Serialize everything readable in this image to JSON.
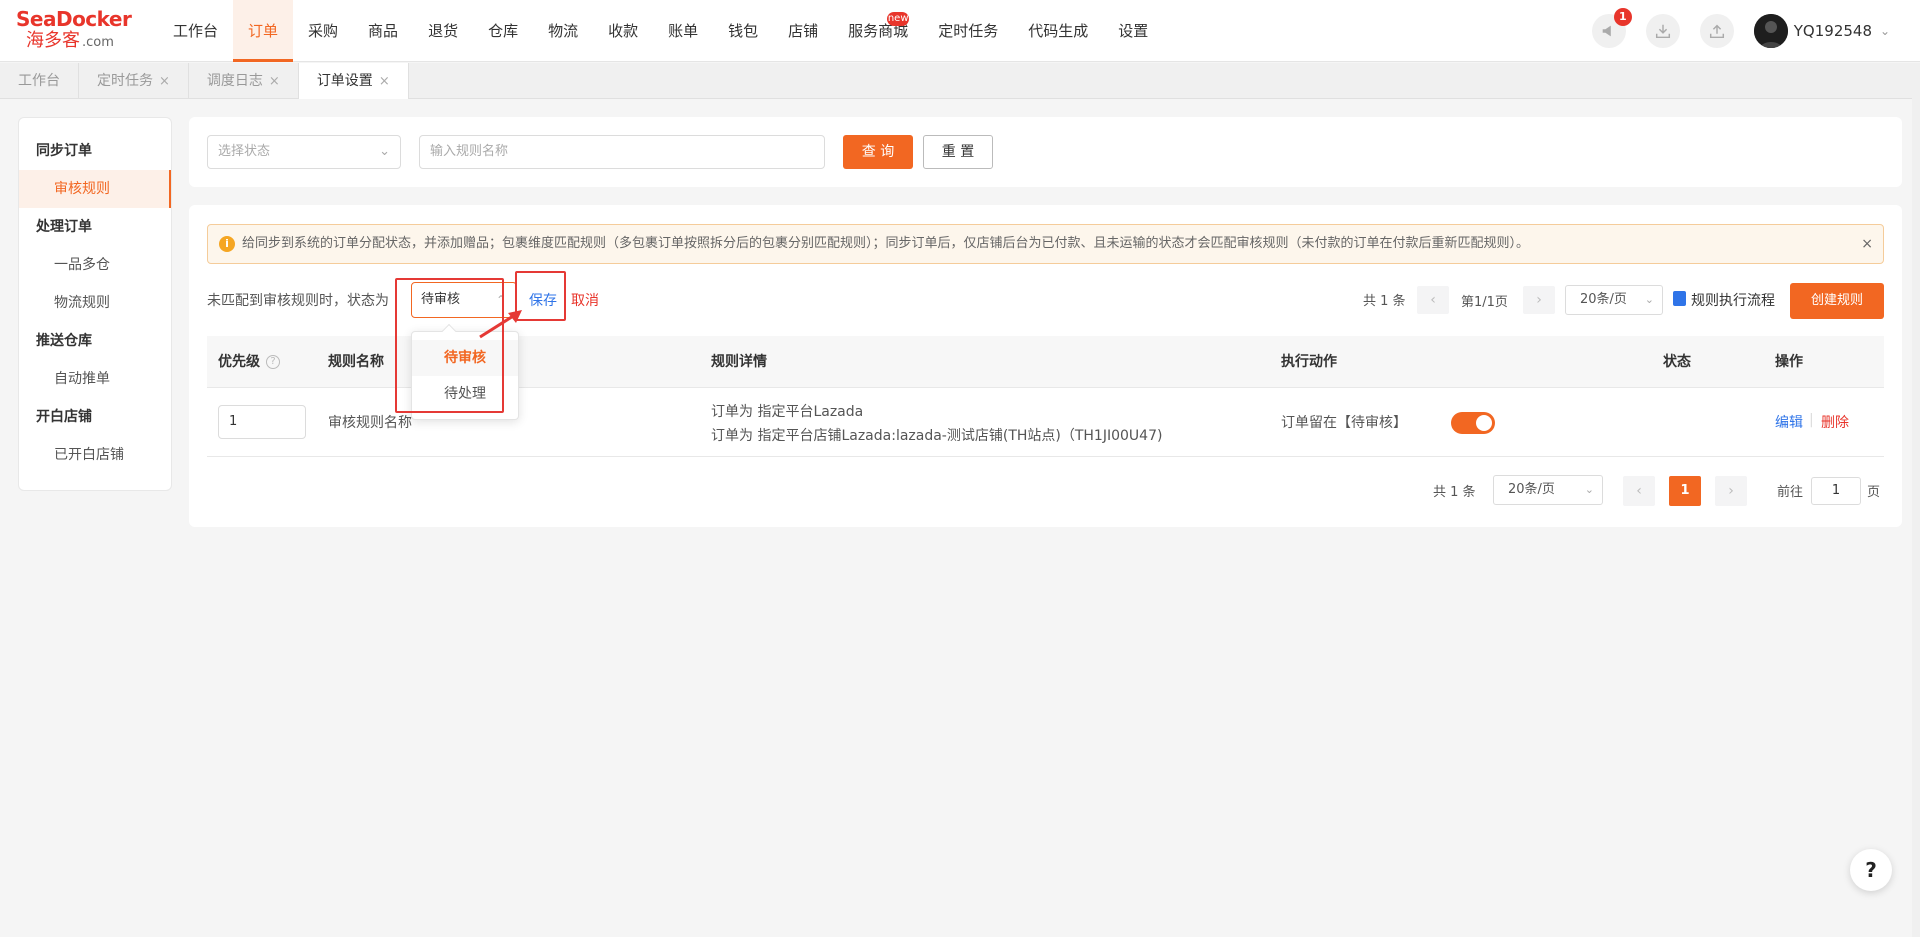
{
  "logo": {
    "text_en": "SeaDocker",
    "text_cn": "海多客",
    "text_domain": ".com"
  },
  "nav": {
    "items": [
      {
        "label": "工作台"
      },
      {
        "label": "订单",
        "active": true
      },
      {
        "label": "采购"
      },
      {
        "label": "商品"
      },
      {
        "label": "退货"
      },
      {
        "label": "仓库"
      },
      {
        "label": "物流"
      },
      {
        "label": "收款"
      },
      {
        "label": "账单"
      },
      {
        "label": "钱包"
      },
      {
        "label": "店铺"
      },
      {
        "label": "服务商城",
        "badge": "new"
      },
      {
        "label": "定时任务"
      },
      {
        "label": "代码生成"
      },
      {
        "label": "设置"
      }
    ]
  },
  "header": {
    "notification_count": "1",
    "username": "YQ192548",
    "icons": [
      "megaphone-icon",
      "download-icon",
      "upload-icon",
      "avatar",
      "chevron-down-icon"
    ]
  },
  "tabs": [
    {
      "label": "工作台"
    },
    {
      "label": "定时任务",
      "closable": "×"
    },
    {
      "label": "调度日志",
      "closable": "×"
    },
    {
      "label": "订单设置",
      "closable": "×",
      "active": true
    }
  ],
  "sidebar": {
    "groups": [
      {
        "label": "同步订单",
        "items": [
          {
            "label": "审核规则",
            "active": true
          }
        ]
      },
      {
        "label": "处理订单",
        "items": [
          {
            "label": "一品多仓"
          },
          {
            "label": "物流规则"
          }
        ]
      },
      {
        "label": "推送仓库",
        "items": [
          {
            "label": "自动推单"
          }
        ]
      },
      {
        "label": "开白店铺",
        "items": [
          {
            "label": "已开白店铺"
          }
        ]
      }
    ]
  },
  "filter": {
    "status_placeholder": "选择状态",
    "name_placeholder": "输入规则名称",
    "query_label": "查 询",
    "reset_label": "重 置"
  },
  "alert": {
    "text": "给同步到系统的订单分配状态，并添加赠品；包裹维度匹配规则（多包裹订单按照拆分后的包裹分别匹配规则）；同步订单后，仅店铺后台为已付款、且未运输的状态才会匹配审核规则（未付款的订单在付款后重新匹配规则）。",
    "close": "×"
  },
  "unmatched": {
    "label": "未匹配到审核规则时，状态为",
    "value": "待审核",
    "save_label": "保存",
    "cancel_label": "取消",
    "options": [
      "待审核",
      "待处理"
    ]
  },
  "top_pager": {
    "total": "共 1 条",
    "page_info": "第1/1页",
    "page_size": "20条/页"
  },
  "flow_link": "规则执行流程",
  "create_label": "创建规则",
  "table": {
    "columns": [
      "优先级",
      "规则名称",
      "规则详情",
      "执行动作",
      "状态",
      "操作"
    ],
    "rows": [
      {
        "priority": "1",
        "name": "审核规则名称",
        "detail_1": "订单为 指定平台Lazada",
        "detail_2": "订单为 指定平台店铺Lazada:lazada-测试店铺(TH站点)（TH1JI00U47)",
        "action": "订单留在【待审核】",
        "enabled": true,
        "edit_label": "编辑",
        "delete_label": "删除"
      }
    ]
  },
  "bottom_pager": {
    "total": "共 1 条",
    "page_size": "20条/页",
    "current_page": "1",
    "goto_label": "前往",
    "goto_value": "1",
    "page_suffix": "页"
  },
  "help_label": "?",
  "colors": {
    "accent": "#f26722",
    "link": "#2f74e8",
    "danger": "#e8352b",
    "annotation": "#e53935"
  }
}
